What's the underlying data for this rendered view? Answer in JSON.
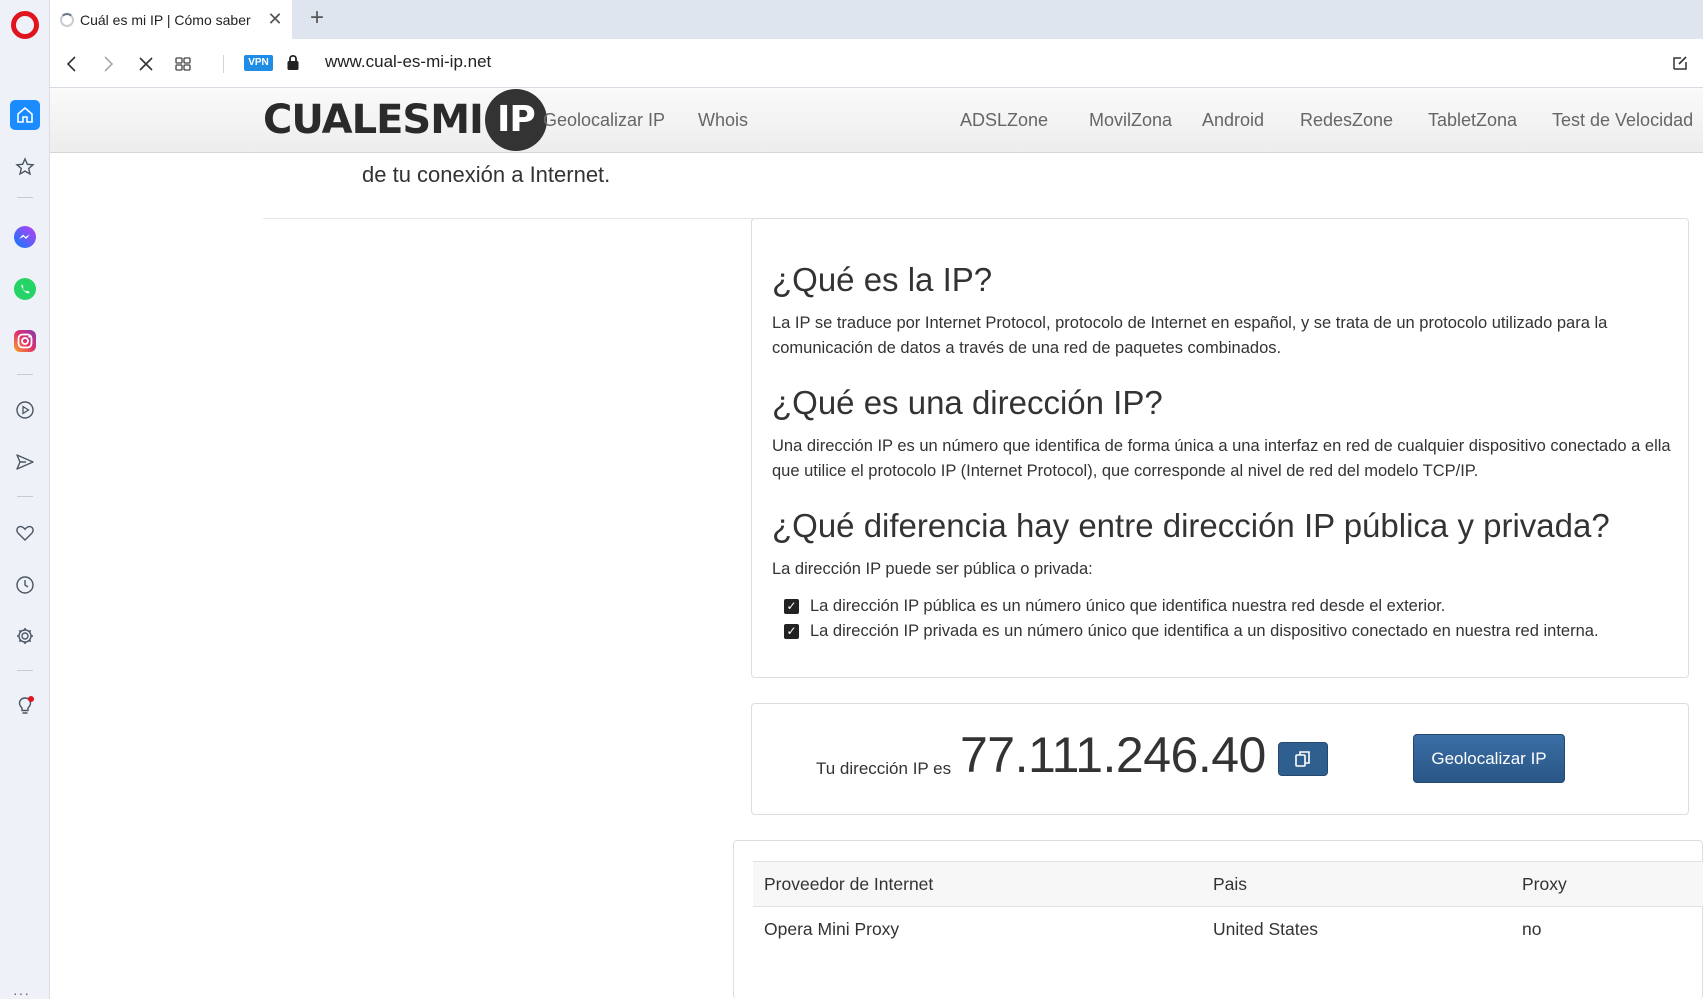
{
  "browser": {
    "tab_title": "Cuál es mi IP | Cómo saber",
    "url": "www.cual-es-mi-ip.net",
    "vpn_label": "VPN",
    "new_tab_label": "+",
    "close_label": "✕"
  },
  "sidebar": {
    "items": [
      "home-icon",
      "star-icon",
      "messenger-icon",
      "whatsapp-icon",
      "instagram-icon",
      "player-icon",
      "send-icon",
      "heart-icon",
      "clock-icon",
      "gear-icon",
      "lightbulb-icon"
    ],
    "more_label": "···"
  },
  "site": {
    "logo_text_a": "CUAL",
    "logo_text_b": "ES",
    "logo_text_c": "MI",
    "logo_circle": "IP",
    "nav_left": [
      "Geolocalizar IP",
      "Whois"
    ],
    "nav_right": [
      "ADSLZone",
      "MovilZona",
      "Android",
      "RedesZone",
      "TabletZona",
      "Test de Velocidad"
    ]
  },
  "content": {
    "intro_line": "de tu conexión a Internet.",
    "q1_title": "¿Qué es la IP?",
    "q1_text": "La IP se traduce por Internet Protocol, protocolo de Internet en español, y se trata de un protocolo utilizado para la comunicación de datos a través de una red de paquetes combinados.",
    "q2_title": "¿Qué es una dirección IP?",
    "q2_text": "Una dirección IP es un número que identifica de forma única a una interfaz en red de cualquier dispositivo conectado a ella que utilice el protocolo IP (Internet Protocol), que corresponde al nivel de red del modelo TCP/IP.",
    "q3_title": "¿Qué diferencia hay entre dirección IP pública y privada?",
    "q3_text": "La dirección IP puede ser pública o privada:",
    "bullets": [
      "La dirección IP pública es un número único que identifica nuestra red desde el exterior.",
      "La dirección IP privada es un número único que identifica a un dispositivo conectado en nuestra red interna."
    ]
  },
  "ip_box": {
    "label": "Tu dirección IP es",
    "value": "77.111.246.40",
    "geo_button": "Geolocalizar IP"
  },
  "table": {
    "headers": [
      "Proveedor de Internet",
      "Pais",
      "Proxy"
    ],
    "rows": [
      [
        "Opera Mini Proxy",
        "United States",
        "no"
      ]
    ]
  },
  "colors": {
    "accent": "#1a8cff",
    "button": "#2f5f8f",
    "opera_red": "#e0141e"
  }
}
